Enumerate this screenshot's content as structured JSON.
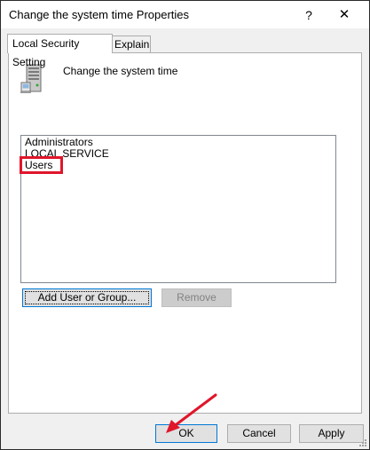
{
  "window": {
    "title": "Change the system time Properties",
    "help_glyph": "?",
    "close_glyph": "✕"
  },
  "tabs": [
    {
      "label": "Local Security Setting",
      "active": true
    },
    {
      "label": "Explain",
      "active": false
    }
  ],
  "policy": {
    "icon": "server-computer-icon",
    "name": "Change the system time"
  },
  "principals": [
    "Administrators",
    "LOCAL SERVICE",
    "Users"
  ],
  "buttons": {
    "add": "Add User or Group...",
    "remove": "Remove",
    "ok": "OK",
    "cancel": "Cancel",
    "apply": "Apply"
  },
  "annotation": {
    "highlight_color": "#e0162b",
    "arrow_color": "#e0162b",
    "highlighted_item": "Users"
  },
  "colors": {
    "accent": "#0078d7",
    "window_bg": "#f0f0f0",
    "button_bg": "#e1e1e1"
  }
}
